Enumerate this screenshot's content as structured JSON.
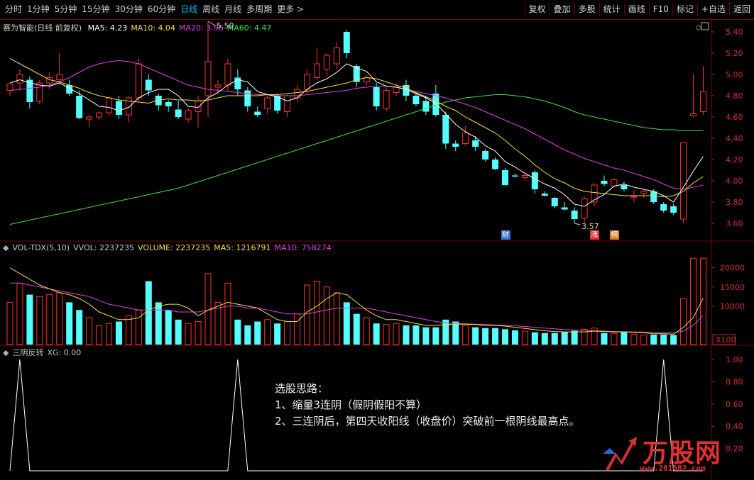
{
  "toolbar": {
    "periods": [
      "分时",
      "1分钟",
      "5分钟",
      "15分钟",
      "30分钟",
      "60分钟",
      "日线",
      "周线",
      "月线",
      "多周期",
      "更多 >"
    ],
    "active_period": "日线",
    "buttons": [
      "复权",
      "叠加",
      "多股",
      "统计",
      "画线",
      "F10",
      "标记",
      "+自选",
      "返回"
    ]
  },
  "price_pane": {
    "title": "赛为智能(日线 前复权)",
    "indicators": [
      {
        "label": "MA5: 4.23",
        "color": "#ffffff"
      },
      {
        "label": "MA10: 4.04",
        "color": "#f0e040"
      },
      {
        "label": "MA20: 3.96",
        "color": "#e040e0"
      },
      {
        "label": "MA60: 4.47",
        "color": "#40e040"
      }
    ],
    "high_label": "5.50",
    "low_label": "3.57",
    "badges": [
      {
        "text": "财",
        "color": "#3a78d0",
        "index": 50
      },
      {
        "text": "涨",
        "color": "#e03030",
        "index": 59
      },
      {
        "text": "榜",
        "color": "#e08020",
        "index": 61
      }
    ]
  },
  "volume_pane": {
    "indicators": [
      {
        "label": "VOL-TDX(5,10)",
        "color": "#c8c8c8"
      },
      {
        "label": "VVOL: 2237235",
        "color": "#c8c8c8"
      },
      {
        "label": "VOLUME: 2237235",
        "color": "#f0e040"
      },
      {
        "label": "MA5: 1216791",
        "color": "#f0e040"
      },
      {
        "label": "MA10: 758274",
        "color": "#e040e0"
      }
    ],
    "unit_label": "X100"
  },
  "signal_pane": {
    "indicators": [
      {
        "label": "三阴反转",
        "color": "#c8c8c8"
      },
      {
        "label": "XG: 0.00",
        "color": "#c8c8c8"
      }
    ]
  },
  "annotation": {
    "lines": [
      "选股思路：",
      "1、缩量3连阴（假阴假阳不算）",
      "2、三连阴后，第四天收阳线（收盘价）突破前一根阴线最高点。"
    ]
  },
  "watermark": {
    "logo_text": "万股网",
    "url": "www.201082.com"
  },
  "colors": {
    "up": "#ff3030",
    "down": "#54ffff",
    "grid": "#7a0000",
    "ma5": "#ffffff",
    "ma10": "#f0e040",
    "ma20": "#e040e0",
    "ma60": "#40e040"
  },
  "chart_data": [
    {
      "type": "candlestick",
      "title": "赛为智能(日线 前复权)",
      "ylim": [
        3.5,
        5.5
      ],
      "y_ticks": [
        3.6,
        3.8,
        4.0,
        4.2,
        4.4,
        4.6,
        4.8,
        5.0,
        5.2,
        5.4
      ],
      "ohlc": [
        [
          4.85,
          4.92,
          4.8,
          4.91
        ],
        [
          4.92,
          5.05,
          4.85,
          5.0
        ],
        [
          4.95,
          4.98,
          4.68,
          4.74
        ],
        [
          4.75,
          4.95,
          4.72,
          4.92
        ],
        [
          4.92,
          5.02,
          4.86,
          4.97
        ],
        [
          4.95,
          5.2,
          4.9,
          5.0
        ],
        [
          4.9,
          4.95,
          4.8,
          4.82
        ],
        [
          4.8,
          4.85,
          4.58,
          4.59
        ],
        [
          4.58,
          4.62,
          4.5,
          4.6
        ],
        [
          4.6,
          4.65,
          4.57,
          4.64
        ],
        [
          4.64,
          4.8,
          4.61,
          4.78
        ],
        [
          4.75,
          4.8,
          4.58,
          4.62
        ],
        [
          4.62,
          4.8,
          4.55,
          4.78
        ],
        [
          4.78,
          5.15,
          4.75,
          5.1
        ],
        [
          4.95,
          5.0,
          4.8,
          4.85
        ],
        [
          4.8,
          4.82,
          4.66,
          4.71
        ],
        [
          4.74,
          4.76,
          4.65,
          4.7
        ],
        [
          4.67,
          4.75,
          4.58,
          4.6
        ],
        [
          4.58,
          4.68,
          4.55,
          4.66
        ],
        [
          4.65,
          4.8,
          4.5,
          4.75
        ],
        [
          4.8,
          5.5,
          4.6,
          5.12
        ],
        [
          4.88,
          4.95,
          4.82,
          4.9
        ],
        [
          4.9,
          5.15,
          4.85,
          5.1
        ],
        [
          4.97,
          5.05,
          4.8,
          4.86
        ],
        [
          4.85,
          4.88,
          4.65,
          4.7
        ],
        [
          4.65,
          4.7,
          4.6,
          4.62
        ],
        [
          4.68,
          4.8,
          4.63,
          4.78
        ],
        [
          4.8,
          4.82,
          4.63,
          4.66
        ],
        [
          4.65,
          4.82,
          4.6,
          4.8
        ],
        [
          4.78,
          4.9,
          4.74,
          4.86
        ],
        [
          4.86,
          5.05,
          4.82,
          5.0
        ],
        [
          4.97,
          5.25,
          4.95,
          5.1
        ],
        [
          5.05,
          5.2,
          4.98,
          5.18
        ],
        [
          5.1,
          5.3,
          5.05,
          5.25
        ],
        [
          5.4,
          5.42,
          5.15,
          5.2
        ],
        [
          5.08,
          5.1,
          4.88,
          4.93
        ],
        [
          4.93,
          5.0,
          4.9,
          4.97
        ],
        [
          4.88,
          4.92,
          4.66,
          4.7
        ],
        [
          4.68,
          4.88,
          4.65,
          4.85
        ],
        [
          4.83,
          4.9,
          4.8,
          4.88
        ],
        [
          4.9,
          4.95,
          4.75,
          4.8
        ],
        [
          4.8,
          4.82,
          4.7,
          4.72
        ],
        [
          4.75,
          4.8,
          4.62,
          4.65
        ],
        [
          4.82,
          4.9,
          4.6,
          4.62
        ],
        [
          4.62,
          4.65,
          4.3,
          4.35
        ],
        [
          4.35,
          4.38,
          4.28,
          4.32
        ],
        [
          4.35,
          4.52,
          4.33,
          4.45
        ],
        [
          4.38,
          4.42,
          4.28,
          4.32
        ],
        [
          4.28,
          4.3,
          4.18,
          4.2
        ],
        [
          4.2,
          4.22,
          4.1,
          4.11
        ]
      ],
      "ohlc_tail": [
        [
          4.1,
          4.12,
          3.95,
          3.96
        ],
        [
          4.05,
          4.07,
          4.03,
          4.04
        ],
        [
          4.03,
          4.08,
          4.0,
          4.05
        ],
        [
          4.08,
          4.1,
          3.88,
          3.92
        ],
        [
          3.88,
          3.9,
          3.85,
          3.86
        ],
        [
          3.84,
          3.85,
          3.74,
          3.76
        ],
        [
          3.75,
          3.8,
          3.72,
          3.73
        ],
        [
          3.72,
          3.75,
          3.6,
          3.64
        ],
        [
          3.65,
          3.85,
          3.6,
          3.83
        ],
        [
          3.8,
          3.98,
          3.76,
          3.96
        ],
        [
          4.0,
          4.05,
          3.95,
          3.97
        ],
        [
          3.95,
          4.02,
          3.94,
          4.01
        ],
        [
          3.96,
          3.99,
          3.9,
          3.92
        ],
        [
          3.84,
          3.91,
          3.8,
          3.85
        ],
        [
          3.88,
          3.92,
          3.84,
          3.9
        ],
        [
          3.9,
          3.92,
          3.78,
          3.8
        ],
        [
          3.78,
          3.8,
          3.7,
          3.72
        ],
        [
          3.76,
          3.78,
          3.68,
          3.7
        ],
        [
          3.64,
          4.36,
          3.6,
          4.36
        ],
        [
          4.61,
          5.0,
          4.6,
          4.63
        ],
        [
          4.65,
          5.08,
          4.62,
          4.84
        ]
      ],
      "ma5": [
        4.92,
        4.95,
        4.92,
        4.9,
        4.89,
        4.92,
        4.87,
        4.82,
        4.76,
        4.7,
        4.69,
        4.66,
        4.69,
        4.78,
        4.83,
        4.86,
        4.86,
        4.8,
        4.7,
        4.69,
        4.78,
        4.83,
        4.9,
        4.95,
        4.93,
        4.84,
        4.81,
        4.79,
        4.75,
        4.78,
        4.86,
        4.92,
        4.96,
        5.02,
        5.1,
        5.06,
        5.03,
        4.93,
        4.89,
        4.88,
        4.86,
        4.82,
        4.78,
        4.73,
        4.63,
        4.53,
        4.46,
        4.41,
        4.33,
        4.28,
        4.18,
        4.13,
        4.07,
        4.02,
        3.97,
        3.93,
        3.87,
        3.78,
        3.76,
        3.82,
        3.87,
        3.95,
        3.97,
        3.94,
        3.92,
        3.9,
        3.86,
        3.8,
        3.94,
        4.09,
        4.23
      ],
      "ma10": [
        5.15,
        5.1,
        5.05,
        5.0,
        4.95,
        4.93,
        4.9,
        4.87,
        4.83,
        4.8,
        4.78,
        4.76,
        4.75,
        4.74,
        4.73,
        4.76,
        4.77,
        4.76,
        4.76,
        4.75,
        4.76,
        4.78,
        4.8,
        4.8,
        4.8,
        4.8,
        4.81,
        4.81,
        4.82,
        4.83,
        4.84,
        4.86,
        4.88,
        4.9,
        4.92,
        4.95,
        4.97,
        4.96,
        4.93,
        4.9,
        4.87,
        4.83,
        4.79,
        4.75,
        4.7,
        4.66,
        4.6,
        4.55,
        4.5,
        4.45,
        4.38,
        4.3,
        4.23,
        4.15,
        4.08,
        4.02,
        3.98,
        3.93,
        3.9,
        3.89,
        3.88,
        3.87,
        3.86,
        3.86,
        3.86,
        3.86,
        3.85,
        3.86,
        3.9,
        3.98,
        4.04
      ],
      "ma20": [
        4.85,
        4.86,
        4.87,
        4.88,
        4.9,
        4.93,
        4.97,
        5.02,
        5.07,
        5.1,
        5.12,
        5.13,
        5.12,
        5.1,
        5.06,
        5.02,
        4.98,
        4.94,
        4.9,
        4.88,
        4.86,
        4.85,
        4.84,
        4.83,
        4.82,
        4.81,
        4.81,
        4.8,
        4.8,
        4.8,
        4.81,
        4.82,
        4.83,
        4.84,
        4.85,
        4.87,
        4.88,
        4.89,
        4.89,
        4.88,
        4.86,
        4.84,
        4.82,
        4.8,
        4.78,
        4.75,
        4.72,
        4.69,
        4.65,
        4.61,
        4.57,
        4.53,
        4.49,
        4.44,
        4.39,
        4.34,
        4.29,
        4.25,
        4.21,
        4.18,
        4.15,
        4.12,
        4.1,
        4.07,
        4.04,
        4.01,
        3.97,
        3.93,
        3.92,
        3.94,
        3.96
      ],
      "ma60": [
        3.59,
        3.61,
        3.63,
        3.65,
        3.67,
        3.69,
        3.71,
        3.73,
        3.75,
        3.77,
        3.79,
        3.81,
        3.83,
        3.85,
        3.87,
        3.89,
        3.91,
        3.93,
        3.96,
        3.99,
        4.02,
        4.05,
        4.08,
        4.11,
        4.14,
        4.17,
        4.2,
        4.23,
        4.26,
        4.29,
        4.32,
        4.35,
        4.38,
        4.41,
        4.44,
        4.47,
        4.5,
        4.53,
        4.56,
        4.59,
        4.62,
        4.65,
        4.68,
        4.71,
        4.74,
        4.76,
        4.78,
        4.79,
        4.8,
        4.81,
        4.81,
        4.8,
        4.79,
        4.77,
        4.75,
        4.72,
        4.69,
        4.65,
        4.62,
        4.6,
        4.58,
        4.56,
        4.54,
        4.52,
        4.5,
        4.49,
        4.48,
        4.48,
        4.47,
        4.47,
        4.47
      ]
    },
    {
      "type": "bar",
      "title": "VOL-TDX(5,10)",
      "unit": "X100",
      "ylim": [
        0,
        24000
      ],
      "y_ticks": [
        10000,
        15000,
        20000
      ],
      "values": [
        11000,
        16000,
        13000,
        12500,
        13000,
        13500,
        11000,
        9000,
        7000,
        5000,
        5500,
        6000,
        7500,
        9000,
        16500,
        11000,
        9000,
        6500,
        5500,
        6000,
        18500,
        11000,
        16000,
        6500,
        5000,
        6000,
        6500,
        5500,
        6000,
        8000,
        15500,
        16500,
        15000,
        13500,
        11000,
        8000,
        7000,
        5500,
        5200,
        5500,
        5000,
        5000,
        4500,
        4500,
        6500,
        6000,
        5000,
        4500,
        4300,
        4300,
        4000,
        3700,
        3500,
        3200,
        3000,
        3000,
        3300,
        3600,
        4000,
        4300,
        3000,
        2900,
        3200,
        2700,
        2500,
        2600,
        2600,
        2500,
        12000,
        22500,
        22500
      ],
      "ma5": [
        20000,
        18500,
        17000,
        15500,
        14500,
        13500,
        13000,
        12000,
        10500,
        8500,
        7500,
        6500,
        6500,
        7000,
        9000,
        10000,
        10500,
        10500,
        9500,
        7500,
        9000,
        10000,
        11000,
        10500,
        10000,
        9500,
        8000,
        6500,
        6000,
        6000,
        8500,
        10000,
        12000,
        13500,
        13000,
        11000,
        9000,
        7500,
        6500,
        6500,
        6000,
        5500,
        5000,
        5000,
        5200,
        5300,
        5300,
        5200,
        5000,
        5000,
        4800,
        4500,
        4200,
        3900,
        3600,
        3400,
        3300,
        3300,
        3300,
        3500,
        3400,
        3300,
        3300,
        3200,
        3100,
        2800,
        2800,
        2700,
        4500,
        7000,
        12100
      ],
      "ma10": [
        16000,
        16000,
        15500,
        15000,
        14500,
        14000,
        13500,
        13000,
        12500,
        11500,
        10500,
        10000,
        9500,
        9000,
        9000,
        9000,
        9000,
        8500,
        8500,
        8500,
        9000,
        9500,
        10000,
        10000,
        9500,
        9500,
        9000,
        8500,
        8000,
        8000,
        8000,
        8500,
        9000,
        9500,
        9500,
        9500,
        9500,
        9000,
        8500,
        8000,
        7500,
        7000,
        6500,
        6000,
        5700,
        5500,
        5400,
        5300,
        5200,
        5100,
        5000,
        4900,
        4700,
        4500,
        4300,
        4100,
        3900,
        3800,
        3700,
        3600,
        3500,
        3400,
        3350,
        3300,
        3250,
        3200,
        3100,
        3050,
        3500,
        5000,
        7600
      ]
    },
    {
      "type": "line",
      "title": "三阴反转",
      "ylim": [
        0,
        1.05
      ],
      "y_ticks": [
        0.2,
        0.4,
        0.6,
        0.8,
        1.0
      ],
      "signal_indices": [
        1,
        23,
        66
      ],
      "values_note": "XG: 0.00"
    }
  ]
}
